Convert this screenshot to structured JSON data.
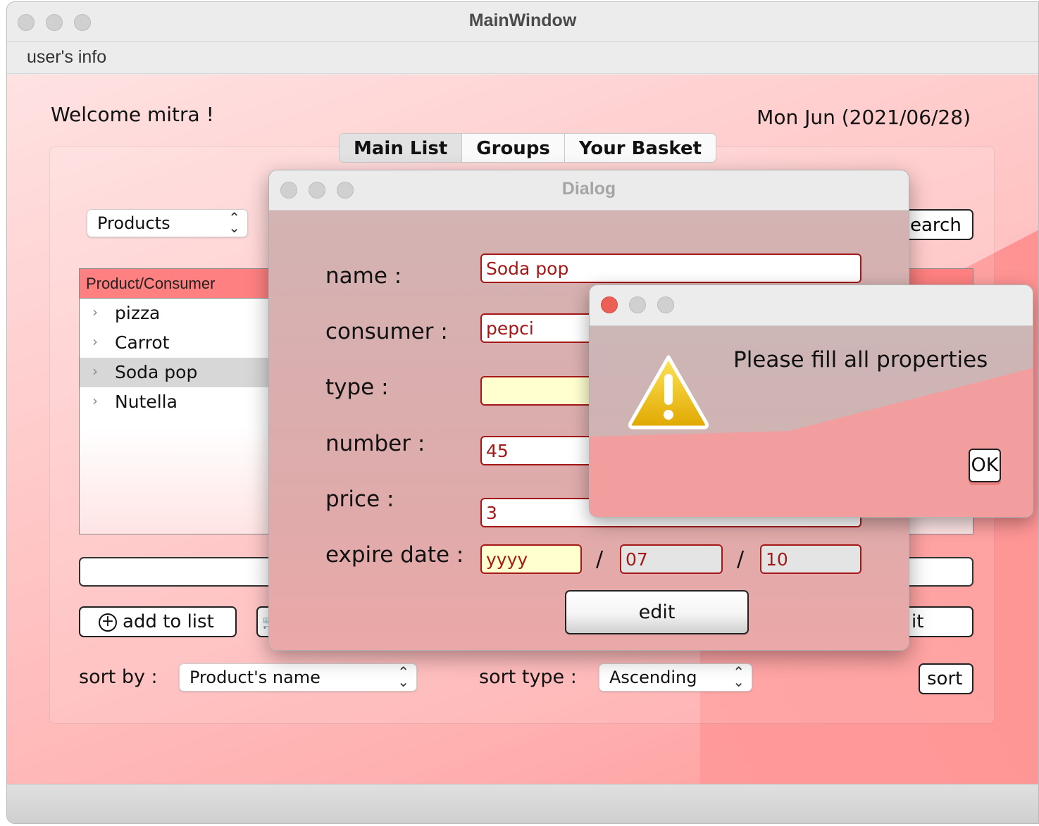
{
  "window": {
    "title": "MainWindow"
  },
  "menubar": {
    "items": [
      "user's info"
    ]
  },
  "header": {
    "welcome": "Welcome mitra !",
    "date": "Mon Jun (2021/06/28)"
  },
  "tabs": [
    "Main List",
    "Groups",
    "Your Basket"
  ],
  "filter": {
    "category": "Products",
    "search_label": "earch"
  },
  "tree": {
    "header": "Product/Consumer",
    "rows": [
      "pizza",
      "Carrot",
      "Soda pop",
      "Nutella"
    ],
    "selected": "Soda pop"
  },
  "buttons": {
    "add_to_list": "add to list",
    "partial_right": "it",
    "sort": "sort"
  },
  "sort": {
    "by_label": "sort by :",
    "by_value": "Product's name",
    "type_label": "sort type :",
    "type_value": "Ascending"
  },
  "dialog": {
    "title": "Dialog",
    "labels": {
      "name": "name :",
      "consumer": "consumer :",
      "type": "type :",
      "number": "number :",
      "price": "price :",
      "expire": "expire date :"
    },
    "values": {
      "name": "Soda pop",
      "consumer": "pepci",
      "type": "",
      "number": "45",
      "price": "3",
      "year": "yyyy",
      "month": "07",
      "day": "10"
    },
    "edit_label": "edit"
  },
  "message": {
    "text": "Please fill all properties",
    "ok_label": "OK",
    "icon": "warning-icon"
  },
  "colors": {
    "accent": "#ff8080",
    "field_border": "#a51818",
    "close_red": "#ec5f57"
  }
}
